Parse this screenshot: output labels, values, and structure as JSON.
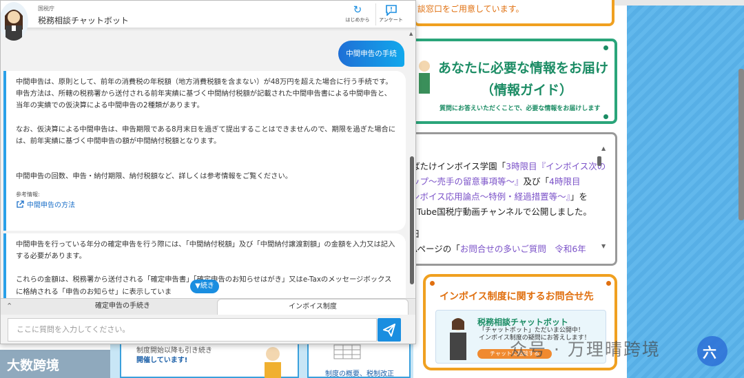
{
  "chat": {
    "header": {
      "org": "国税庁",
      "bot_name": "税務相談チャットボット",
      "restart_label": "はじめから",
      "survey_label": "アンケート"
    },
    "user_message": "中間申告の手続",
    "bot_message_1": {
      "para1": "中間申告は、原則として、前年の消費税の年税額（地方消費税額を含まない）が48万円を超えた場合に行う手続です。\n申告方法は、所轄の税務署から送付される前年実績に基づく中間納付税額が記載された中間申告書による中間申告と、当年の実績での仮決算による中間申告の2種類があります。",
      "para2": "なお、仮決算による中間申告は、申告期限である8月末日を過ぎて提出することはできませんので、期限を過ぎた場合には、前年実績に基づく中間申告の額が中間納付税額となります。",
      "para3": "中間申告の回数、申告・納付期限、納付税額など、詳しくは参考情報をご覧ください。",
      "ref_label": "参考情報:",
      "ref_link": "中間申告の方法"
    },
    "bot_message_2": {
      "para1": "中間申告を行っている年分の確定申告を行う際には、「中間納付税額」及び「中間納付譲渡割額」の金額を入力又は記入する必要があります。",
      "para2": "これらの金額は、税務署から送付される「確定申告書」「確定申告のお知らせはがき」又はe-Taxのメッセージボックスに格納される「申告のお知らせ」に表示していま"
    },
    "continue_label": "▼続き",
    "tabs": [
      "確定申告の手続き",
      "インボイス制度"
    ],
    "input_placeholder": "ここに質問を入力してください。"
  },
  "background": {
    "top_card_text": "談窓口をご用意しています。",
    "info_title_1": "あなたに必要な情報をお届け",
    "info_title_2": "（情報ガイド）",
    "info_sub": "質問にお答えいただくことで、必要な情報をお届けします",
    "news_line1_pre": "ばたけインボイス学園「",
    "news_line1_link": "3時限目『インボイス次の",
    "news_line2_link": "ップ～売手の留意事項等～』",
    "news_line2_post": "及び「",
    "news_line2_link2": "4時限目",
    "news_line3_link": "ンボイス応用論点～特例・経過措置等～』",
    "news_line3_post": "」を",
    "news_line4": "uTube国税庁動画チャンネルで公開しました。",
    "news_line5": "日",
    "news_line6_pre": "Aページの「",
    "news_line6_link": "お問合せの多いご質問　令和6年",
    "invoice_title": "インボイス制度に関するお問合せ先",
    "invoice_bot_title": "税務相談チャットボット",
    "invoice_bot_sub1": "「チャットボット」ただいま公開中！",
    "invoice_bot_sub2": "インボイス制度の疑問にお答えします！",
    "invoice_bot_button": "チャットに相談する",
    "bottom_card_text1": "制度開始以降も引き続き",
    "bottom_card_text2": "開催しています!",
    "bottom_card2_text": "制度の概要、税制改正",
    "watermark": "众号 · 万理晴跨境",
    "logo_text": "大数跨境"
  },
  "colors": {
    "accent_blue": "#1a8ee0",
    "green": "#1b8c64",
    "orange": "#f0a020",
    "link": "#1a6fc8"
  }
}
